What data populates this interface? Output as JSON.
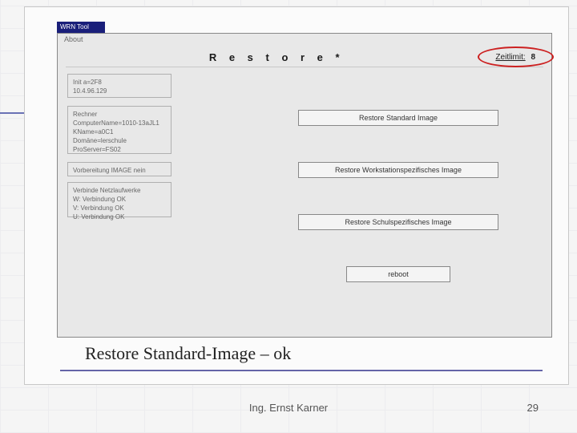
{
  "titlebar": "WRN Tool",
  "menu": "About",
  "header": {
    "title": "R e s t o r e  *",
    "zeitlimit_label": "Zeitlimit:",
    "zeitlimit_value": "8"
  },
  "info": {
    "box1": "Init a=2F8\n10.4.96.129",
    "box2": "Rechner\nComputerName=1010-13aJL1\nKName=a0C1\nDomäne=lerschule\nProServer=FS02",
    "box3": "Vorbereitung IMAGE   nein",
    "box4": "Verbinde Netzlaufwerke\nW: Verbindung OK\nV: Verbindung OK\nU: Verbindung OK"
  },
  "buttons": {
    "b1": "Restore Standard Image",
    "b2": "Restore Workstationspezifisches Image",
    "b3": "Restore Schulspezifisches Image",
    "b4": "reboot"
  },
  "caption": "Restore Standard-Image – ok",
  "footer": {
    "author": "Ing. Ernst Karner",
    "page": "29"
  }
}
